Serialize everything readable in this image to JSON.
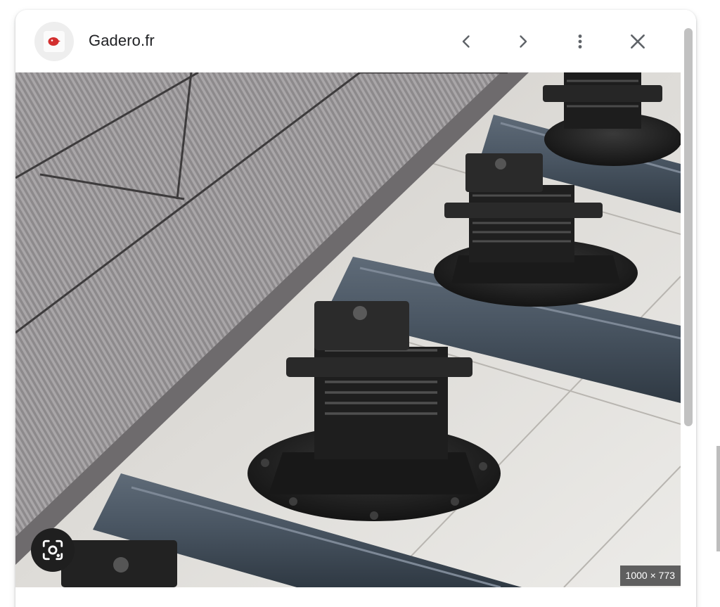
{
  "panel": {
    "site_name": "Gadero.fr",
    "favicon_icon": "gadero-logo-icon",
    "favicon_color": "#d32f2f"
  },
  "header_buttons": {
    "previous": "chevron-left-icon",
    "next": "chevron-right-icon",
    "more": "more-vert-icon",
    "close": "close-icon"
  },
  "image": {
    "subject": "composite decking boards on adjustable plastic pedestals and aluminium joists",
    "dimensions_label": "1000 × 773",
    "lens_button_icon": "google-lens-icon"
  },
  "colors": {
    "panel_bg": "#ffffff",
    "text": "#202124",
    "icon": "#5f6368",
    "scrollbar_thumb": "#c1c1c1"
  }
}
